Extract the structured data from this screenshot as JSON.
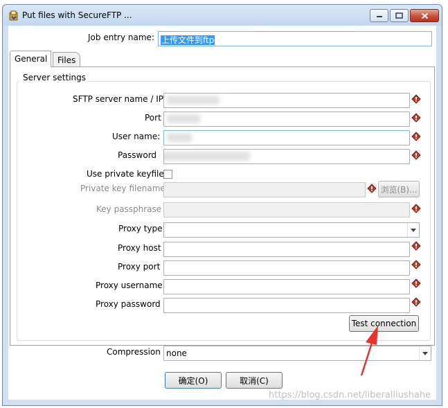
{
  "window": {
    "title": "Put files with SecureFTP ...",
    "minimize_icon": "minimize-icon",
    "maximize_icon": "maximize-icon",
    "close_icon": "close-icon"
  },
  "job_entry": {
    "label": "Job entry name:",
    "value": "上传文件到ftp"
  },
  "tabs": [
    {
      "label": "General",
      "active": true
    },
    {
      "label": "Files",
      "active": false
    }
  ],
  "server_settings": {
    "title": "Server settings",
    "sftp_server_label": "SFTP server name / IP",
    "port_label": "Port",
    "username_label": "User name:",
    "password_label": "Password",
    "use_private_keyfile_label": "Use private keyfile",
    "use_private_keyfile_checked": false,
    "private_key_filename_label": "Private key filename",
    "browse_label": "浏览(B)...",
    "key_passphrase_label": "Key passphrase",
    "proxy_type_label": "Proxy type",
    "proxy_type_value": "",
    "proxy_host_label": "Proxy host",
    "proxy_port_label": "Proxy port",
    "proxy_username_label": "Proxy username",
    "proxy_password_label": "Proxy password",
    "test_connection_label": "Test connection"
  },
  "compression": {
    "label": "Compression",
    "value": "none"
  },
  "footer": {
    "ok_label": "确定(O)",
    "cancel_label": "取消(C)"
  },
  "watermark": "https://blog.csdn.net/liberalliushahe",
  "colors": {
    "annotation_arrow": "#e8322b",
    "selection": "#3399ff",
    "variable_diamond": "#c0392b"
  }
}
